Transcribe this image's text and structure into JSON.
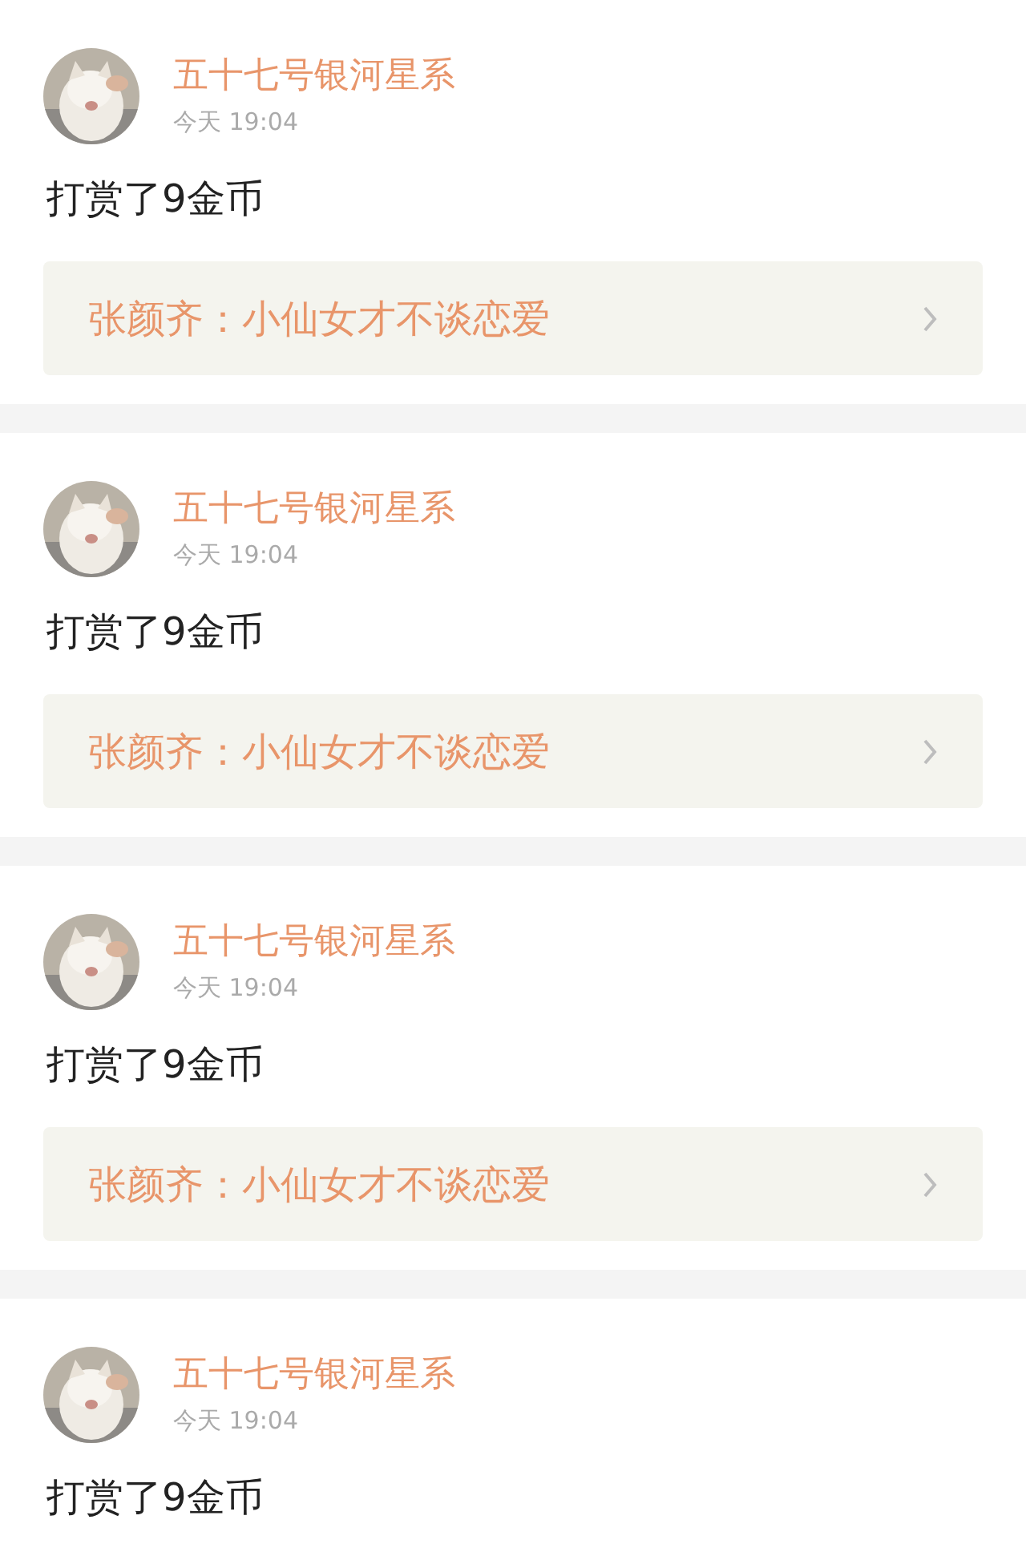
{
  "posts": [
    {
      "user": "五十七号银河星系",
      "time": "今天 19:04",
      "text": "打赏了9金币",
      "link": "张颜齐：小仙女才不谈恋爱"
    },
    {
      "user": "五十七号银河星系",
      "time": "今天 19:04",
      "text": "打赏了9金币",
      "link": "张颜齐：小仙女才不谈恋爱"
    },
    {
      "user": "五十七号银河星系",
      "time": "今天 19:04",
      "text": "打赏了9金币",
      "link": "张颜齐：小仙女才不谈恋爱"
    },
    {
      "user": "五十七号银河星系",
      "time": "今天 19:04",
      "text": "打赏了9金币"
    }
  ]
}
